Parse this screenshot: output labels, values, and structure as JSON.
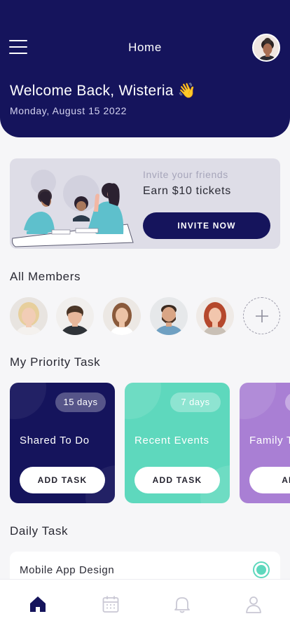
{
  "header": {
    "title": "Home",
    "welcome": "Welcome Back, Wisteria 👋",
    "date": "Monday, August 15 2022"
  },
  "invite": {
    "subtitle": "Invite your friends",
    "headline": "Earn $10 tickets",
    "button": "INVITE NOW"
  },
  "members": {
    "title": "All Members"
  },
  "priority": {
    "title": "My Priority Task",
    "tasks": [
      {
        "badge": "15 days",
        "name": "Shared To Do",
        "button": "ADD TASK",
        "color": "#15145c"
      },
      {
        "badge": "7 days",
        "name": "Recent Events",
        "button": "ADD TASK",
        "color": "#5ed8bd"
      },
      {
        "badge": "",
        "name": "Family T",
        "button": "ADD",
        "color": "#a97fd4"
      }
    ]
  },
  "daily": {
    "title": "Daily Task",
    "items": [
      {
        "label": "Mobile App Design",
        "done": true
      }
    ]
  },
  "nav": {
    "items": [
      {
        "icon": "home-icon",
        "active": true
      },
      {
        "icon": "calendar-icon",
        "active": false
      },
      {
        "icon": "bell-icon",
        "active": false
      },
      {
        "icon": "profile-icon",
        "active": false
      }
    ]
  },
  "colors": {
    "primary": "#15145c",
    "accent_teal": "#5ed8bd",
    "accent_purple": "#a97fd4"
  }
}
